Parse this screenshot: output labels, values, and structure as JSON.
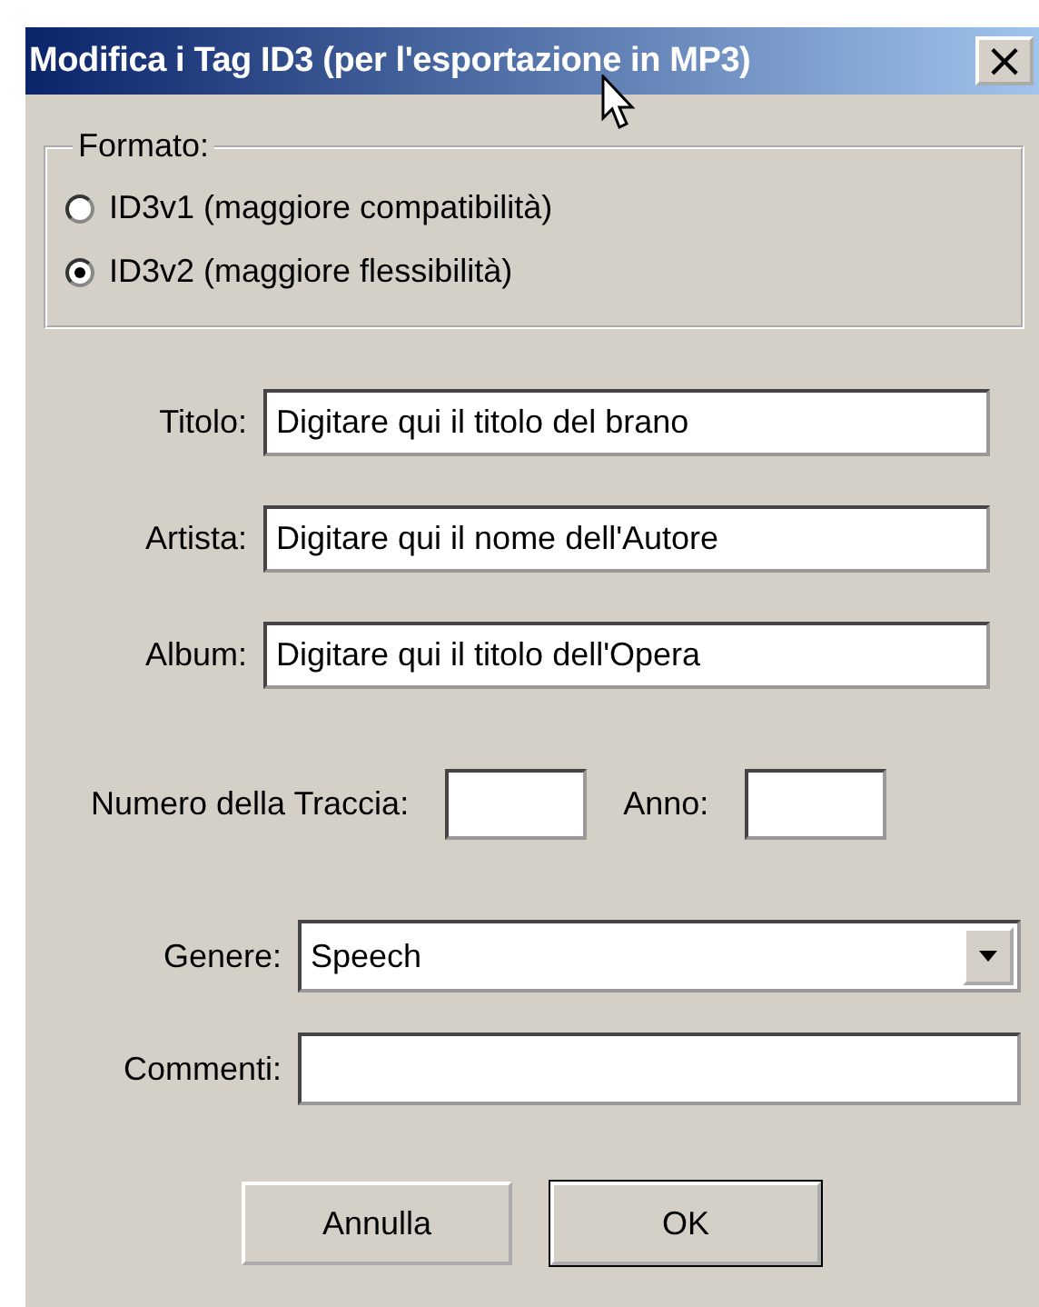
{
  "window": {
    "title": "Modifica i Tag ID3 (per l'esportazione in MP3)",
    "close": "×"
  },
  "format": {
    "legend": "Formato:",
    "options": [
      {
        "label": "ID3v1 (maggiore compatibilità)",
        "selected": false
      },
      {
        "label": "ID3v2 (maggiore flessibilità)",
        "selected": true
      }
    ]
  },
  "fields": [
    {
      "label": "Titolo:",
      "value": "Digitare qui il titolo del brano"
    },
    {
      "label": "Artista:",
      "value": "Digitare qui il nome dell'Autore"
    },
    {
      "label": "Album:",
      "value": "Digitare qui il titolo dell'Opera"
    }
  ],
  "track": {
    "label": "Numero della Traccia:"
  },
  "year": {
    "label": "Anno:"
  },
  "genre": {
    "label": "Genere:",
    "value": "Speech"
  },
  "comments": {
    "label": "Commenti:"
  },
  "buttons": [
    {
      "label": "Annulla",
      "default": false
    },
    {
      "label": "OK",
      "default": true
    }
  ]
}
